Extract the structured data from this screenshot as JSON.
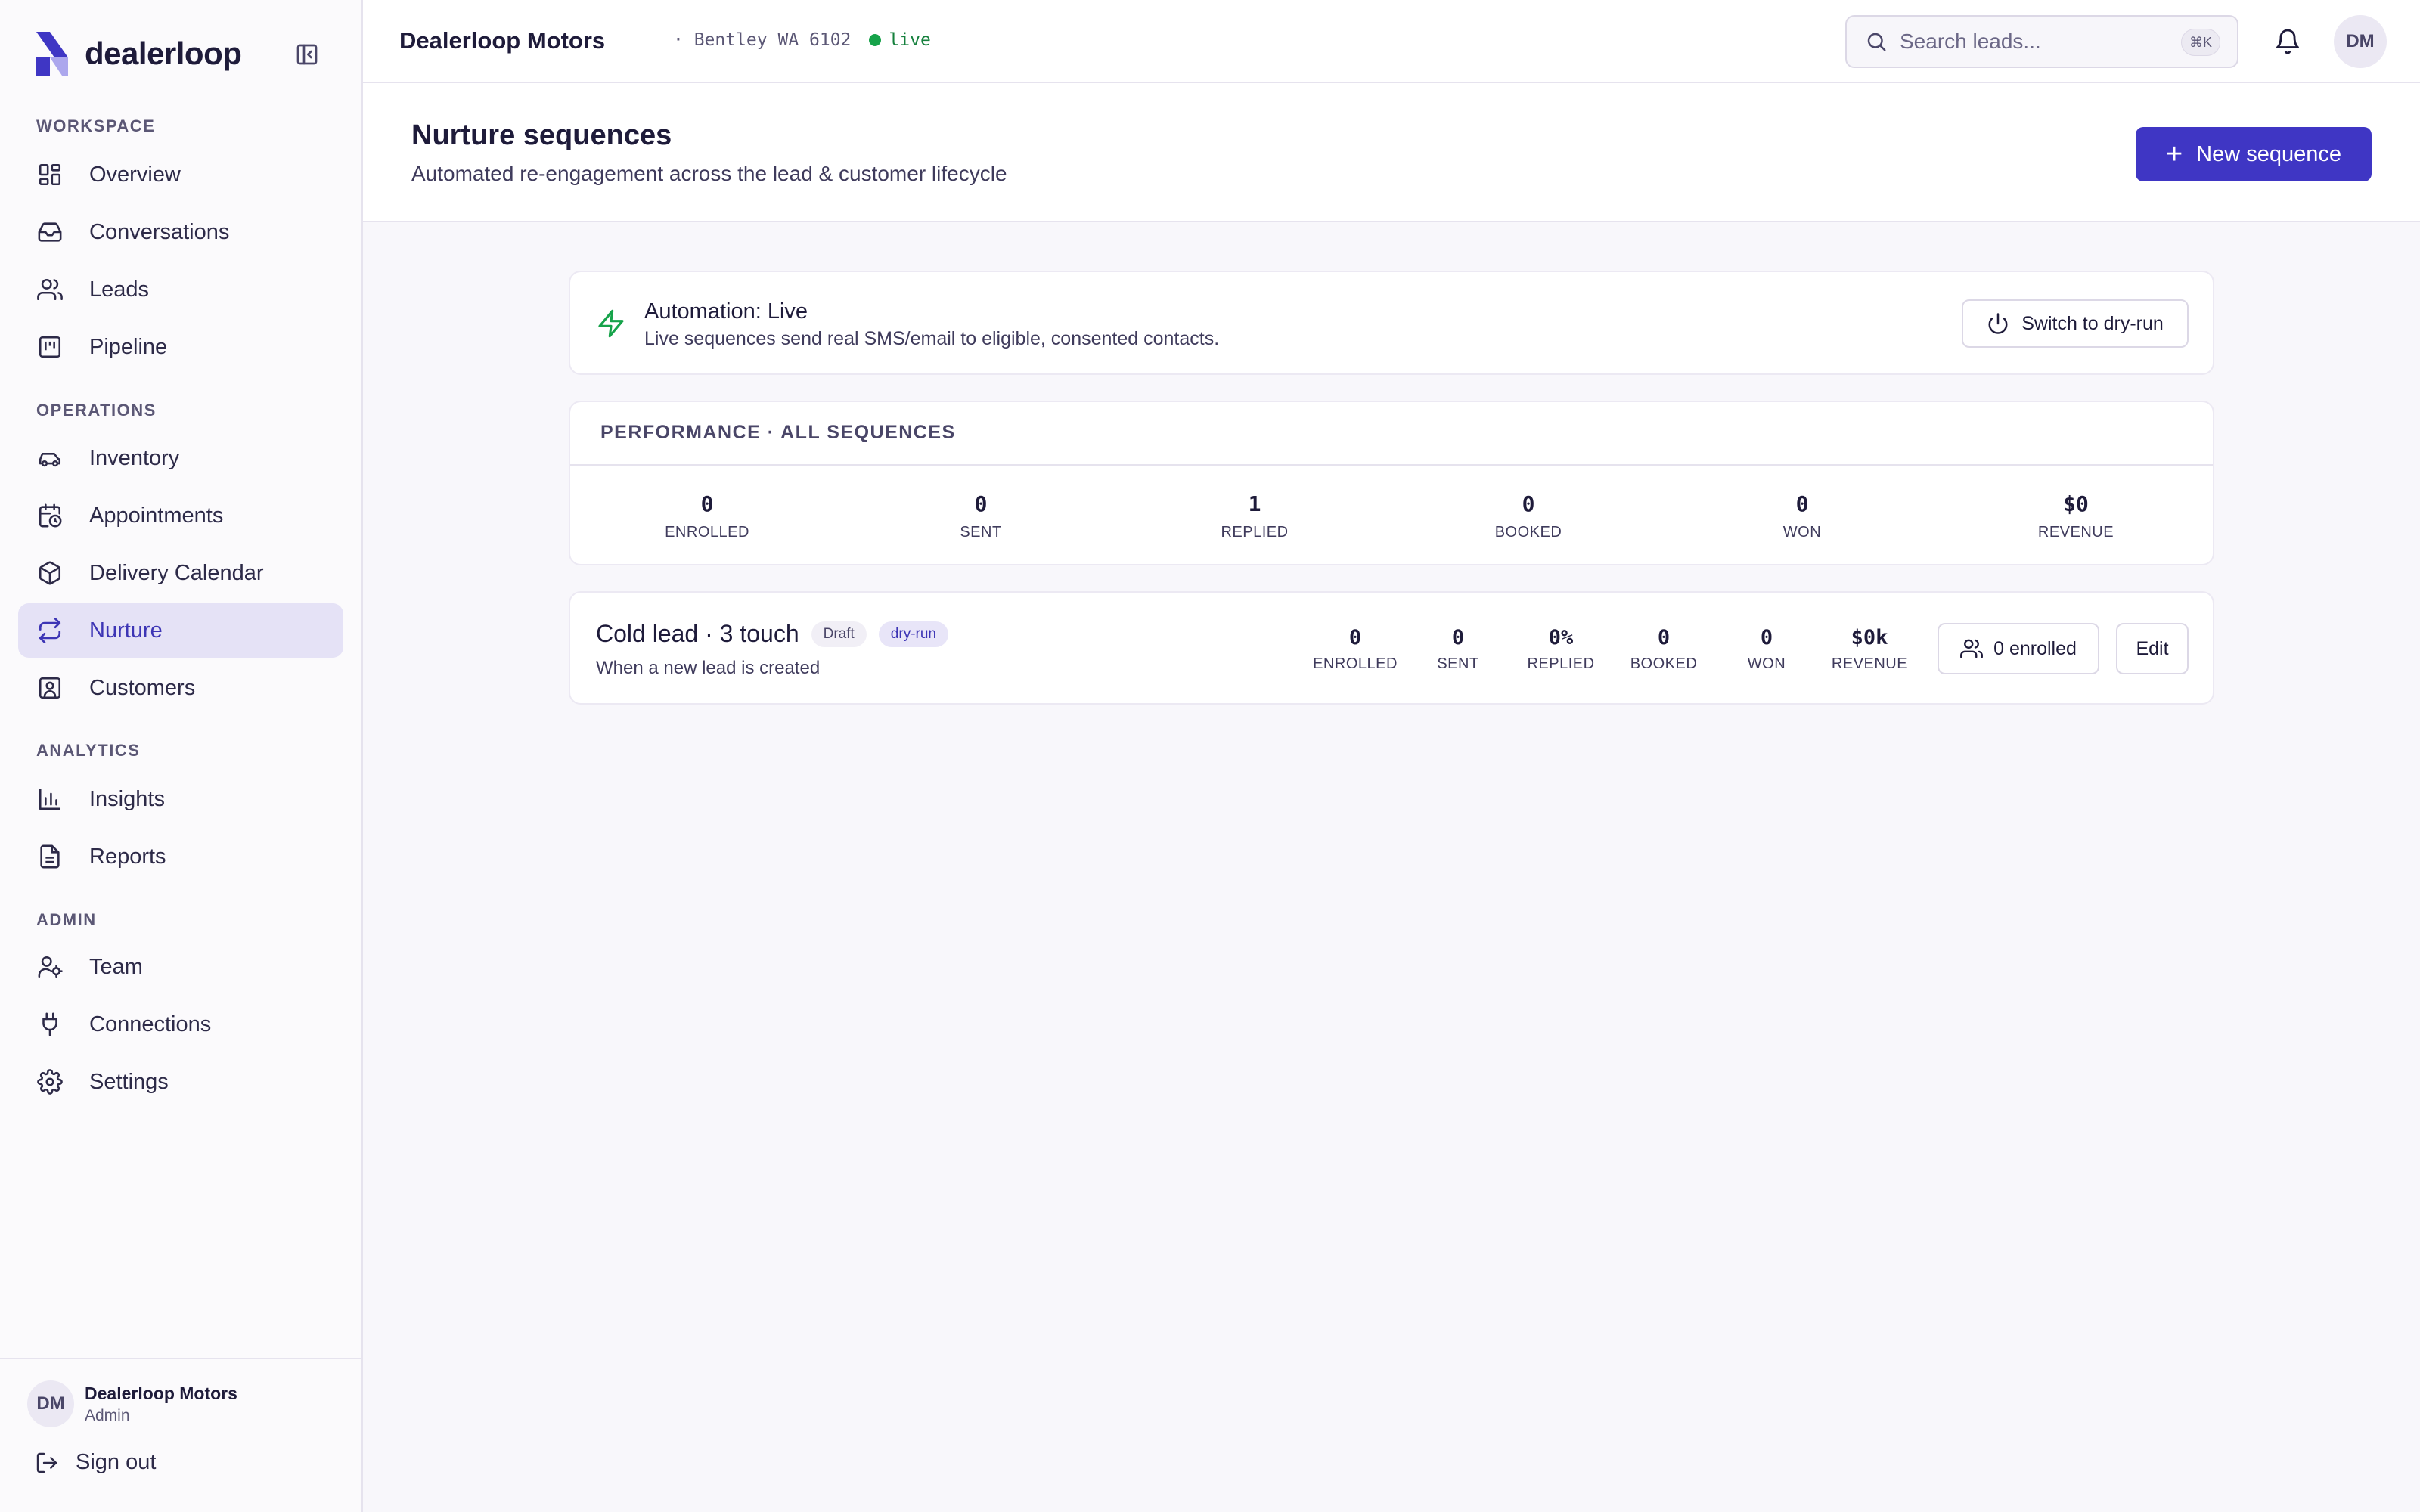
{
  "brand": {
    "name": "dealerloop",
    "accent": "#3f36c4"
  },
  "sidebar": {
    "sections": [
      {
        "title": "WORKSPACE",
        "items": [
          {
            "label": "Overview",
            "icon": "grid-icon"
          },
          {
            "label": "Conversations",
            "icon": "inbox-icon"
          },
          {
            "label": "Leads",
            "icon": "users-icon"
          },
          {
            "label": "Pipeline",
            "icon": "kanban-icon"
          }
        ]
      },
      {
        "title": "OPERATIONS",
        "items": [
          {
            "label": "Inventory",
            "icon": "car-icon"
          },
          {
            "label": "Appointments",
            "icon": "calendar-clock-icon"
          },
          {
            "label": "Delivery Calendar",
            "icon": "package-icon"
          },
          {
            "label": "Nurture",
            "icon": "repeat-icon",
            "active": true
          },
          {
            "label": "Customers",
            "icon": "contact-icon"
          }
        ]
      },
      {
        "title": "ANALYTICS",
        "items": [
          {
            "label": "Insights",
            "icon": "bar-chart-icon"
          },
          {
            "label": "Reports",
            "icon": "file-text-icon"
          }
        ]
      },
      {
        "title": "ADMIN",
        "items": [
          {
            "label": "Team",
            "icon": "user-cog-icon"
          },
          {
            "label": "Connections",
            "icon": "plug-icon"
          },
          {
            "label": "Settings",
            "icon": "gear-icon"
          }
        ]
      }
    ],
    "footer": {
      "avatar_initials": "DM",
      "user_name": "Dealerloop Motors",
      "user_role": "Admin",
      "sign_out_label": "Sign out"
    }
  },
  "topbar": {
    "org_name": "Dealerloop Motors",
    "location": "· Bentley WA 6102",
    "status": "live",
    "search_placeholder": "Search leads...",
    "search_shortcut": "⌘K",
    "avatar_initials": "DM"
  },
  "header": {
    "title": "Nurture sequences",
    "subtitle": "Automated re-engagement across the lead & customer lifecycle",
    "new_button_label": "New sequence"
  },
  "automation": {
    "title": "Automation: Live",
    "description": "Live sequences send real SMS/email to eligible, consented contacts.",
    "toggle_label": "Switch to dry-run"
  },
  "performance": {
    "heading": "PERFORMANCE · ALL SEQUENCES",
    "stats": [
      {
        "value": "0",
        "label": "ENROLLED"
      },
      {
        "value": "0",
        "label": "SENT"
      },
      {
        "value": "1",
        "label": "REPLIED"
      },
      {
        "value": "0",
        "label": "BOOKED"
      },
      {
        "value": "0",
        "label": "WON"
      },
      {
        "value": "$0",
        "label": "REVENUE"
      }
    ]
  },
  "sequences": [
    {
      "name": "Cold lead · 3 touch",
      "badges": [
        "Draft",
        "dry-run"
      ],
      "trigger": "When a new lead is created",
      "stats": [
        {
          "value": "0",
          "label": "ENROLLED"
        },
        {
          "value": "0",
          "label": "SENT"
        },
        {
          "value": "0%",
          "label": "REPLIED"
        },
        {
          "value": "0",
          "label": "BOOKED"
        },
        {
          "value": "0",
          "label": "WON"
        },
        {
          "value": "$0k",
          "label": "REVENUE"
        }
      ],
      "enrolled_label": "0 enrolled",
      "edit_label": "Edit"
    }
  ]
}
